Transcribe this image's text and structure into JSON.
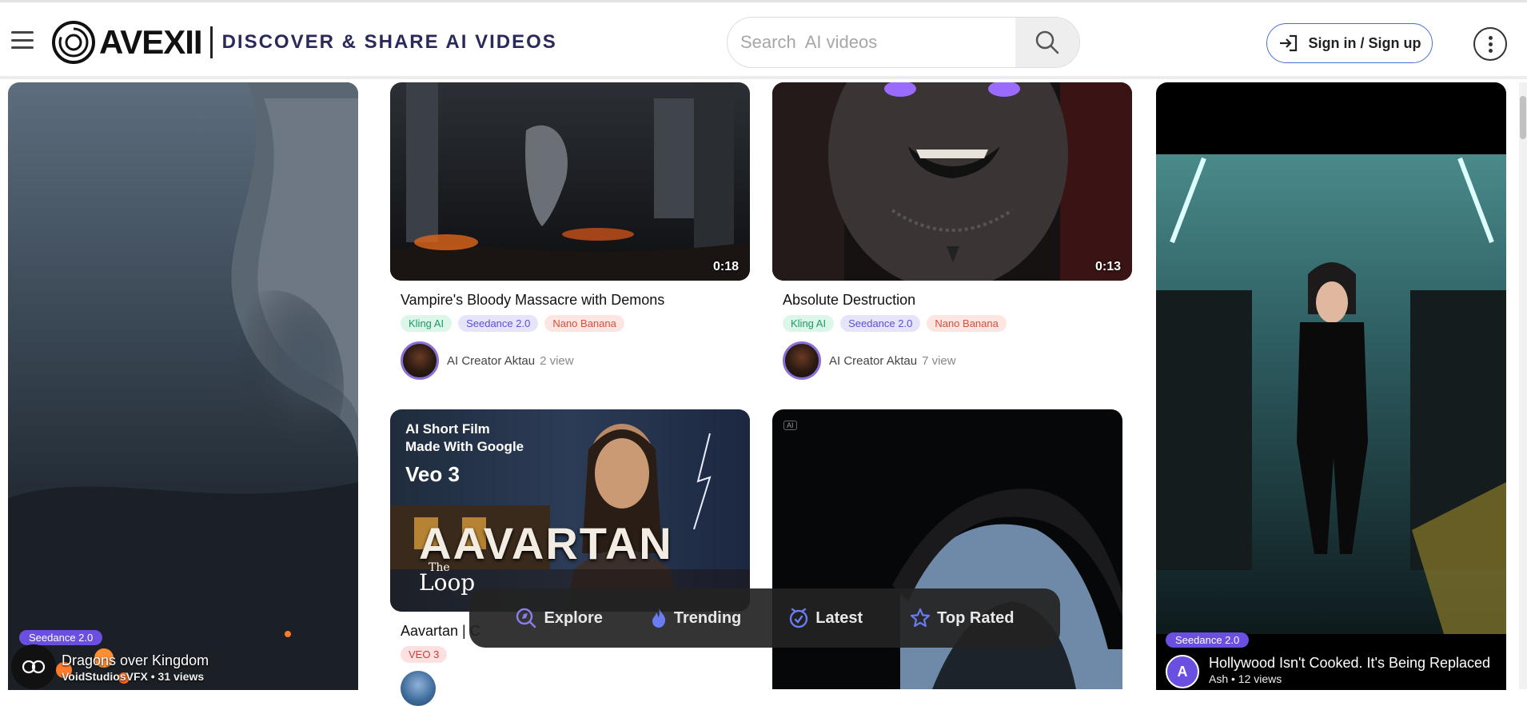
{
  "header": {
    "brand": "AVEXII",
    "tagline": "DISCOVER & SHARE AI VIDEOS",
    "search_placeholder": "Search  AI videos",
    "sign_in_label": "Sign in / Sign up"
  },
  "cards": {
    "dragons": {
      "badge": "Seedance 2.0",
      "title": "Dragons over Kingdom",
      "subtitle": "VoidStudiosVFX • 31 views"
    },
    "vampire": {
      "duration": "0:18",
      "title": "Vampire's Bloody Massacre with Demons",
      "tags": [
        "Kling AI",
        "Seedance 2.0",
        "Nano Banana"
      ],
      "author": "AI Creator Aktau",
      "views": "2 view"
    },
    "absolute": {
      "duration": "0:13",
      "title": "Absolute Destruction",
      "tags": [
        "Kling AI",
        "Seedance 2.0",
        "Nano Banana"
      ],
      "author": "AI Creator Aktau",
      "views": "7 view"
    },
    "aavartan": {
      "poster_line1": "AI Short Film",
      "poster_line2": "Made With Google",
      "poster_line3": "Veo 3",
      "poster_title": "AAVARTAN",
      "poster_sub1": "The",
      "poster_sub2": "Loop",
      "title": "Aavartan | C",
      "tag": "VEO 3"
    },
    "dark": {
      "ai_badge": "AI"
    },
    "hollywood": {
      "badge": "Seedance 2.0",
      "avatar_letter": "A",
      "title": "Hollywood Isn't Cooked. It's Being Replaced",
      "subtitle": "Ash • 12 views"
    }
  },
  "floating_nav": {
    "items": [
      "Explore",
      "Trending",
      "Latest",
      "Top Rated"
    ]
  },
  "colors": {
    "accent": "#6b4fe0",
    "signin_border": "#4a6fd6",
    "nav_bg": "#232323"
  }
}
